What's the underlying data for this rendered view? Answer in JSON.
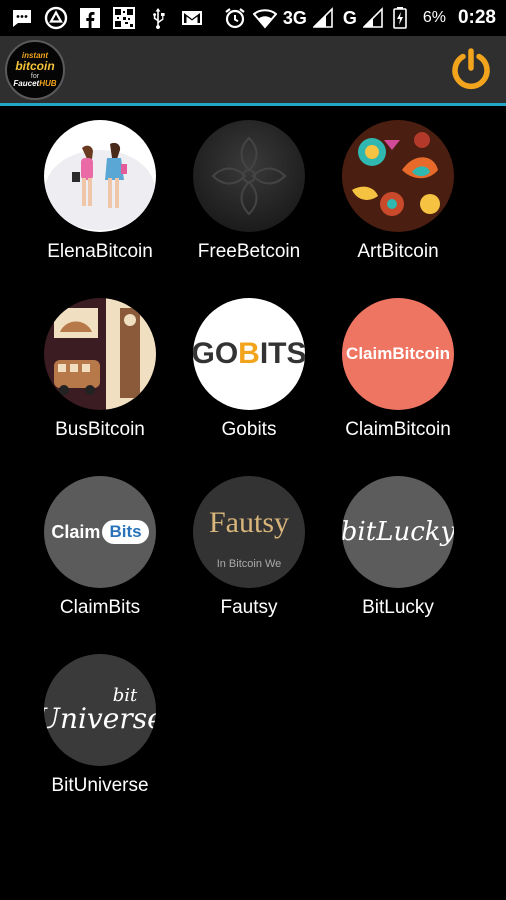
{
  "status_bar": {
    "network": "3G",
    "signal_2": "G",
    "battery": "6%",
    "time": "0:28"
  },
  "app_bar": {
    "logo": {
      "line1": "instant",
      "line2": "bitcoin",
      "line3": "for",
      "line4a": "Faucet",
      "line4b": "HUB"
    }
  },
  "apps": [
    {
      "label": "ElenaBitcoin"
    },
    {
      "label": "FreeBetcoin"
    },
    {
      "label": "ArtBitcoin"
    },
    {
      "label": "BusBitcoin"
    },
    {
      "label": "Gobits",
      "icon_text_a": "GO",
      "icon_text_b": "B",
      "icon_text_c": "ITS"
    },
    {
      "label": "ClaimBitcoin",
      "icon_text": "ClaimBitcoin"
    },
    {
      "label": "ClaimBits",
      "icon_text_a": "Claim",
      "icon_text_b": "Bits"
    },
    {
      "label": "Fautsy",
      "icon_text": "Fautsy",
      "icon_subtext": "In Bitcoin We"
    },
    {
      "label": "BitLucky",
      "icon_text": "bitLucky"
    },
    {
      "label": "BitUniverse",
      "icon_text_top": "bit",
      "icon_text_main": "Universe"
    }
  ],
  "colors": {
    "accent": "#1fa7c7",
    "power": "#f2a41c",
    "app_bar": "#2f2f2f"
  }
}
